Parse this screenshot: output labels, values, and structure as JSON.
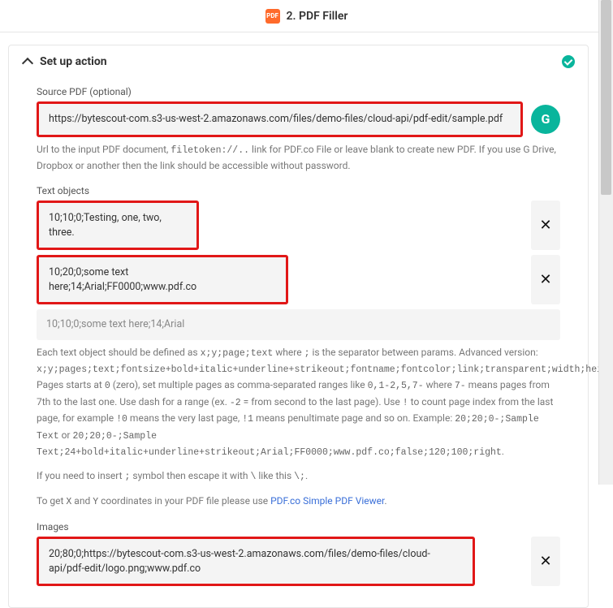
{
  "header": {
    "step_label": "2. PDF Filler"
  },
  "panel": {
    "title": "Set up action"
  },
  "source_pdf": {
    "label": "Source PDF (optional)",
    "value": "https://bytescout-com.s3-us-west-2.amazonaws.com/files/demo-files/cloud-api/pdf-edit/sample.pdf",
    "help_prefix": "Url to the input PDF document, ",
    "help_code": "filetoken://..",
    "help_suffix": " link for PDF.co File or leave blank to create new PDF. If you use G Drive, Dropbox or another then the link should be accessible without password."
  },
  "text_objects": {
    "label": "Text objects",
    "rows": [
      "10;10;0;Testing, one, two, three.",
      "10;20;0;some text here;14;Arial;FF0000;www.pdf.co"
    ],
    "placeholder": "10;10;0;some text here;14;Arial",
    "help_line1_a": "Each text object should be defined as ",
    "help_line1_code": "x;y;page;text",
    "help_line1_b": " where ",
    "help_line1_sep": ";",
    "help_line1_c": " is the separator between params. Advanced version: ",
    "help_line2_code": "x;y;pages;text;fontsize+bold+italic+underline+strikeout;fontname;fontcolor;link;transparent;width;height;alignment",
    "help_line2_b": ". Pages starts at ",
    "help_line2_zero": "0",
    "help_line2_c": " (zero), set multiple pages as comma-separated ranges like ",
    "help_line2_ranges": "0,1-2,5,7-",
    "help_line2_d": " where ",
    "help_line2_seven": "7-",
    "help_line2_e": " means pages from 7th to the last one. Use dash for a range (ex. ",
    "help_line2_neg2": "-2",
    "help_line2_f": " = from second to the last page). Use ",
    "help_line2_bang": "!",
    "help_line2_g": " to count page index from the last page, for example ",
    "help_line2_bang0": "!0",
    "help_line2_h": " means the very last page, ",
    "help_line2_bang1": "!1",
    "help_line2_i": " means penultimate page and so on. Example: ",
    "help_line2_ex1": "20;20;0-;Sample Text",
    "help_line2_j": " or ",
    "help_line2_ex2": "20;20;0-;Sample Text;24+bold+italic+underline+strikeout;Arial;FF0000;www.pdf.co;false;120;100;right",
    "help_line2_k": ".",
    "help_escape_a": "If you need to insert ",
    "help_escape_semi": ";",
    "help_escape_b": " symbol then escape it with ",
    "help_escape_bs": "\\",
    "help_escape_c": " like this ",
    "help_escape_ex": "\\;",
    "help_escape_d": ".",
    "help_coords_a": "To get ",
    "help_coords_x": "X",
    "help_coords_b": " and ",
    "help_coords_y": "Y",
    "help_coords_c": " coordinates in your PDF file please use ",
    "help_coords_link": "PDF.co Simple PDF Viewer",
    "help_coords_d": "."
  },
  "images": {
    "label": "Images",
    "rows": [
      "20;80;0;https://bytescout-com.s3-us-west-2.amazonaws.com/files/demo-files/cloud-api/pdf-edit/logo.png;www.pdf.co"
    ]
  },
  "icons": {
    "remove": "✕",
    "grammarly": "G"
  }
}
